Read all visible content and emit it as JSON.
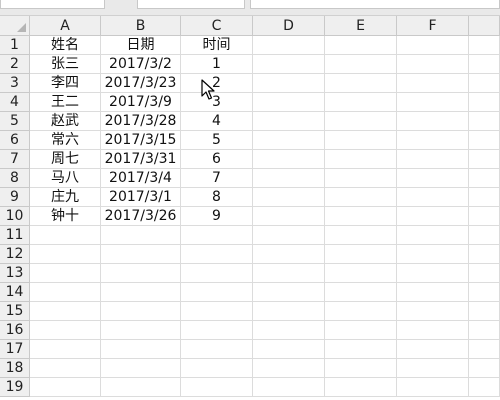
{
  "columns": [
    "A",
    "B",
    "C",
    "D",
    "E",
    "F"
  ],
  "rows": [
    "1",
    "2",
    "3",
    "4",
    "5",
    "6",
    "7",
    "8",
    "9",
    "10",
    "11",
    "12",
    "13",
    "14",
    "15",
    "16",
    "17",
    "18",
    "19"
  ],
  "cells": [
    [
      "姓名",
      "日期",
      "时间"
    ],
    [
      "张三",
      "2017/3/2",
      "1"
    ],
    [
      "李四",
      "2017/3/23",
      "2"
    ],
    [
      "王二",
      "2017/3/9",
      "3"
    ],
    [
      "赵武",
      "2017/3/28",
      "4"
    ],
    [
      "常六",
      "2017/3/15",
      "5"
    ],
    [
      "周七",
      "2017/3/31",
      "6"
    ],
    [
      "马八",
      "2017/3/4",
      "7"
    ],
    [
      "庄九",
      "2017/3/1",
      "8"
    ],
    [
      "钟十",
      "2017/3/26",
      "9"
    ]
  ]
}
